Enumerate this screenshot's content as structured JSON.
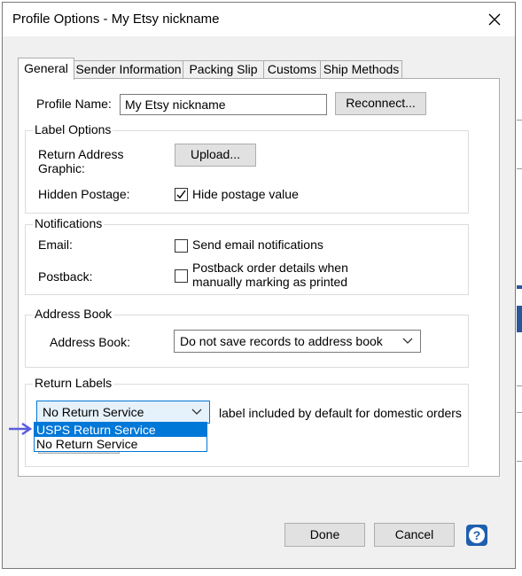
{
  "dialog": {
    "title": "Profile Options - My Etsy nickname"
  },
  "tabs": [
    {
      "label": "General",
      "active": true
    },
    {
      "label": "Sender Information",
      "active": false
    },
    {
      "label": "Packing Slip",
      "active": false
    },
    {
      "label": "Customs",
      "active": false
    },
    {
      "label": "Ship Methods",
      "active": false
    }
  ],
  "profile": {
    "name_label": "Profile Name:",
    "name_value": "My Etsy nickname",
    "reconnect_label": "Reconnect..."
  },
  "label_options": {
    "caption": "Label Options",
    "return_address_label_line1": "Return Address",
    "return_address_label_line2": "Graphic:",
    "upload_label": "Upload...",
    "hidden_postage_label": "Hidden Postage:",
    "hide_postage_checkbox_label": "Hide postage value",
    "hide_postage_checked": true
  },
  "notifications": {
    "caption": "Notifications",
    "email_label": "Email:",
    "email_checkbox_label": "Send email notifications",
    "email_checked": false,
    "postback_label": "Postback:",
    "postback_checkbox_line1": "Postback order details when",
    "postback_checkbox_line2": "manually marking as printed",
    "postback_checked": false
  },
  "address_book": {
    "caption": "Address Book",
    "label": "Address Book:",
    "selected": "Do not save records to address book"
  },
  "return_labels": {
    "caption": "Return Labels",
    "selected": "No Return Service",
    "description": "label included by default for domestic orders",
    "options": [
      "USPS Return Service",
      "No Return Service"
    ],
    "highlighted_option": "USPS Return Service"
  },
  "footer": {
    "done_label": "Done",
    "cancel_label": "Cancel",
    "help_label": "?"
  },
  "colors": {
    "accent": "#0078d7",
    "arrow": "#5b5bdf",
    "help_button": "#1f5fae"
  }
}
